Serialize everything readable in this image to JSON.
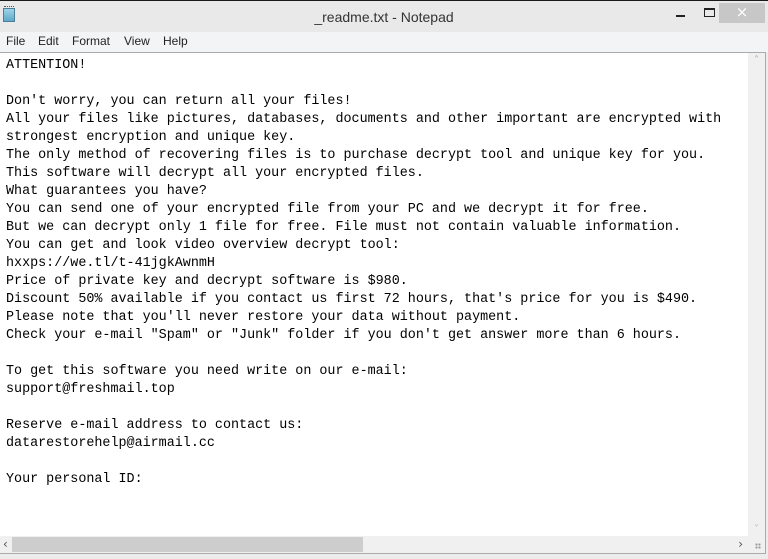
{
  "window": {
    "title": "_readme.txt - Notepad",
    "controls": {
      "minimize": "minimize",
      "maximize": "maximize",
      "close": "×"
    }
  },
  "menu": [
    {
      "label": "File"
    },
    {
      "label": "Edit"
    },
    {
      "label": "Format"
    },
    {
      "label": "View"
    },
    {
      "label": "Help"
    }
  ],
  "document": {
    "lines": [
      "ATTENTION!",
      "",
      "Don't worry, you can return all your files!",
      "All your files like pictures, databases, documents and other important are encrypted with",
      "strongest encryption and unique key.",
      "The only method of recovering files is to purchase decrypt tool and unique key for you.",
      "This software will decrypt all your encrypted files.",
      "What guarantees you have?",
      "You can send one of your encrypted file from your PC and we decrypt it for free.",
      "But we can decrypt only 1 file for free. File must not contain valuable information.",
      "You can get and look video overview decrypt tool:",
      "hxxps://we.tl/t-41jgkAwnmH",
      "Price of private key and decrypt software is $980.",
      "Discount 50% available if you contact us first 72 hours, that's price for you is $490.",
      "Please note that you'll never restore your data without payment.",
      "Check your e-mail \"Spam\" or \"Junk\" folder if you don't get answer more than 6 hours.",
      "",
      "To get this software you need write on our e-mail:",
      "support@freshmail.top",
      "",
      "Reserve e-mail address to contact us:",
      "datarestorehelp@airmail.cc",
      "",
      "Your personal ID:"
    ]
  },
  "scrollbars": {
    "up_arrow": "˄",
    "down_arrow": "˅",
    "left_arrow": "‹",
    "right_arrow": "›"
  }
}
